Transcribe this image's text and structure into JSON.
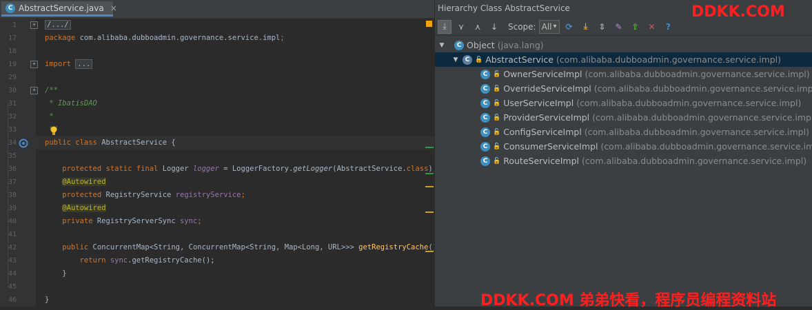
{
  "editor": {
    "tab": {
      "icon": "class-c-icon",
      "icon_letter": "C",
      "title": "AbstractService.java",
      "close": "×"
    },
    "lines": [
      {
        "num": "1",
        "parts": [
          {
            "t": "/.../",
            "c": "fold"
          }
        ]
      },
      {
        "num": "17",
        "parts": [
          {
            "t": "package ",
            "c": "kw"
          },
          {
            "t": "com.alibaba.dubboadmin.governance.service.impl",
            "c": "tx"
          },
          {
            "t": ";",
            "c": "kw"
          }
        ]
      },
      {
        "num": "18",
        "parts": []
      },
      {
        "num": "19",
        "parts": [
          {
            "t": "import ",
            "c": "kw"
          },
          {
            "t": "...",
            "c": "fold"
          }
        ]
      },
      {
        "num": "29",
        "parts": []
      },
      {
        "num": "30",
        "parts": [
          {
            "t": "/**",
            "c": "cm"
          }
        ]
      },
      {
        "num": "31",
        "parts": [
          {
            "t": " * IbatisDAO",
            "c": "cm"
          }
        ]
      },
      {
        "num": "32",
        "parts": [
          {
            "t": " *",
            "c": "cm"
          }
        ]
      },
      {
        "num": "33",
        "parts": [
          {
            "t": " */",
            "c": "cm"
          }
        ]
      },
      {
        "num": "34",
        "parts": [
          {
            "t": "public class ",
            "c": "kw"
          },
          {
            "t": "AbstractService ",
            "c": "tx"
          },
          {
            "t": "{",
            "c": "tx"
          }
        ]
      },
      {
        "num": "35",
        "parts": []
      },
      {
        "num": "36",
        "parts": [
          {
            "t": "    protected static final ",
            "c": "kw"
          },
          {
            "t": "Logger ",
            "c": "tx"
          },
          {
            "t": "logger",
            "c": "fld ital"
          },
          {
            "t": " = LoggerFactory.",
            "c": "tx"
          },
          {
            "t": "getLogger",
            "c": "tx ital"
          },
          {
            "t": "(AbstractService.",
            "c": "tx"
          },
          {
            "t": "class",
            "c": "kw"
          },
          {
            "t": ");",
            "c": "tx"
          }
        ]
      },
      {
        "num": "37",
        "parts": [
          {
            "t": "    ",
            "c": "tx"
          },
          {
            "t": "@Autowired",
            "c": "ann"
          }
        ]
      },
      {
        "num": "38",
        "parts": [
          {
            "t": "    protected ",
            "c": "kw"
          },
          {
            "t": "RegistryService ",
            "c": "tx"
          },
          {
            "t": "registryService",
            "c": "fld"
          },
          {
            "t": ";",
            "c": "kw"
          }
        ]
      },
      {
        "num": "39",
        "parts": [
          {
            "t": "    ",
            "c": "tx"
          },
          {
            "t": "@Autowired",
            "c": "ann"
          }
        ]
      },
      {
        "num": "40",
        "parts": [
          {
            "t": "    private ",
            "c": "kw"
          },
          {
            "t": "RegistryServerSync ",
            "c": "tx"
          },
          {
            "t": "sync",
            "c": "fld"
          },
          {
            "t": ";",
            "c": "kw"
          }
        ]
      },
      {
        "num": "41",
        "parts": []
      },
      {
        "num": "42",
        "parts": [
          {
            "t": "    public ",
            "c": "kw"
          },
          {
            "t": "ConcurrentMap<String, ConcurrentMap<String, Map<Long, URL>>> ",
            "c": "tx"
          },
          {
            "t": "getRegistryCache",
            "c": "fn"
          },
          {
            "t": "() {",
            "c": "tx"
          }
        ]
      },
      {
        "num": "43",
        "parts": [
          {
            "t": "        return ",
            "c": "kw"
          },
          {
            "t": "sync",
            "c": "fld"
          },
          {
            "t": ".getRegistryCache();",
            "c": "tx"
          }
        ]
      },
      {
        "num": "44",
        "parts": [
          {
            "t": "    }",
            "c": "tx"
          }
        ]
      },
      {
        "num": "45",
        "parts": []
      },
      {
        "num": "46",
        "parts": [
          {
            "t": "}",
            "c": "tx"
          }
        ]
      }
    ]
  },
  "hierarchy": {
    "title": "Hierarchy Class AbstractService",
    "toolbar": {
      "buttons": [
        {
          "name": "subtypes-hierarchy-icon",
          "glyph": "⤓",
          "selected": true
        },
        {
          "name": "supertypes-hierarchy-icon",
          "glyph": "⋎",
          "selected": false
        },
        {
          "name": "class-hierarchy-icon",
          "glyph": "⋏",
          "selected": false
        },
        {
          "name": "sort-alphabetically-icon",
          "glyph": "↓",
          "selected": false
        }
      ],
      "scope_label": "Scope:",
      "scope_value": "All",
      "buttons2": [
        {
          "name": "refresh-icon",
          "glyph": "⟳"
        },
        {
          "name": "export-icon",
          "glyph": "⤓"
        },
        {
          "name": "expand-all-icon",
          "glyph": "⇕"
        },
        {
          "name": "pin-icon",
          "glyph": "✎"
        },
        {
          "name": "open-in-new-tab-icon",
          "glyph": "⇧"
        },
        {
          "name": "close-icon",
          "glyph": "✕"
        },
        {
          "name": "help-icon",
          "glyph": "?"
        }
      ]
    },
    "tree": [
      {
        "level": 0,
        "expanded": true,
        "name": "Object",
        "pkg": "(java.lang)",
        "icon": "class-c-icon"
      },
      {
        "level": 1,
        "expanded": true,
        "name": "AbstractService",
        "pkg": "(com.alibaba.dubboadmin.governance.service.impl)",
        "icon": "abstract-class-icon",
        "selected": true
      },
      {
        "level": 2,
        "name": "OwnerServiceImpl",
        "pkg": "(com.alibaba.dubboadmin.governance.service.impl)",
        "icon": "class-c-icon"
      },
      {
        "level": 2,
        "name": "OverrideServiceImpl",
        "pkg": "(com.alibaba.dubboadmin.governance.service.impl)",
        "icon": "class-c-icon"
      },
      {
        "level": 2,
        "name": "UserServiceImpl",
        "pkg": "(com.alibaba.dubboadmin.governance.service.impl)",
        "icon": "class-c-icon"
      },
      {
        "level": 2,
        "name": "ProviderServiceImpl",
        "pkg": "(com.alibaba.dubboadmin.governance.service.impl)",
        "icon": "class-c-icon"
      },
      {
        "level": 2,
        "name": "ConfigServiceImpl",
        "pkg": "(com.alibaba.dubboadmin.governance.service.impl)",
        "icon": "class-c-icon"
      },
      {
        "level": 2,
        "name": "ConsumerServiceImpl",
        "pkg": "(com.alibaba.dubboadmin.governance.service.impl)",
        "icon": "class-c-icon"
      },
      {
        "level": 2,
        "name": "RouteServiceImpl",
        "pkg": "(com.alibaba.dubboadmin.governance.service.impl)",
        "icon": "class-c-icon"
      }
    ]
  },
  "watermarks": {
    "top": "DDKK.COM",
    "bottom": "DDKK.COM 弟弟快看，程序员编程资料站"
  },
  "colors": {
    "accent": "#4a88c7",
    "watermark": "#ff1f1f",
    "selection": "#0d293e"
  }
}
